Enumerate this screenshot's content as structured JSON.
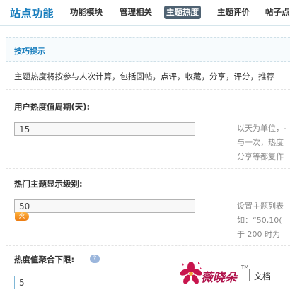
{
  "header": {
    "site_title": "站点功能",
    "nav": [
      {
        "label": "功能模块",
        "active": false
      },
      {
        "label": "管理相关",
        "active": false
      },
      {
        "label": "主题热度",
        "active": true
      },
      {
        "label": "主题评价",
        "active": false
      },
      {
        "label": "帖子点",
        "active": false
      }
    ]
  },
  "tips": {
    "title": "技巧提示",
    "text": "主题热度将按参与人次计算，包括回帖，点评，收藏，分享，评分，推荐"
  },
  "fields": [
    {
      "label": "用户热度值周期(天):",
      "value": "15",
      "desc": [
        "以天为单位，-",
        "与一次，热度",
        "分享等都复作"
      ]
    },
    {
      "label": "热门主题显示级别:",
      "value": "50",
      "flame_label": "火",
      "desc": [
        "设置主题列表",
        "如：“50,10(",
        "于 200 时为"
      ]
    },
    {
      "label": "热度值聚合下限:",
      "value": "5",
      "help_icon": "?"
    }
  ],
  "watermark": {
    "brand": "薇晓朵",
    "tm": "TM",
    "doc": "文档",
    "icon": "flower-icon"
  },
  "colors": {
    "accent": "#1b7fbe",
    "active_tab_bg": "#4f6272",
    "brand": "#b0124b"
  }
}
